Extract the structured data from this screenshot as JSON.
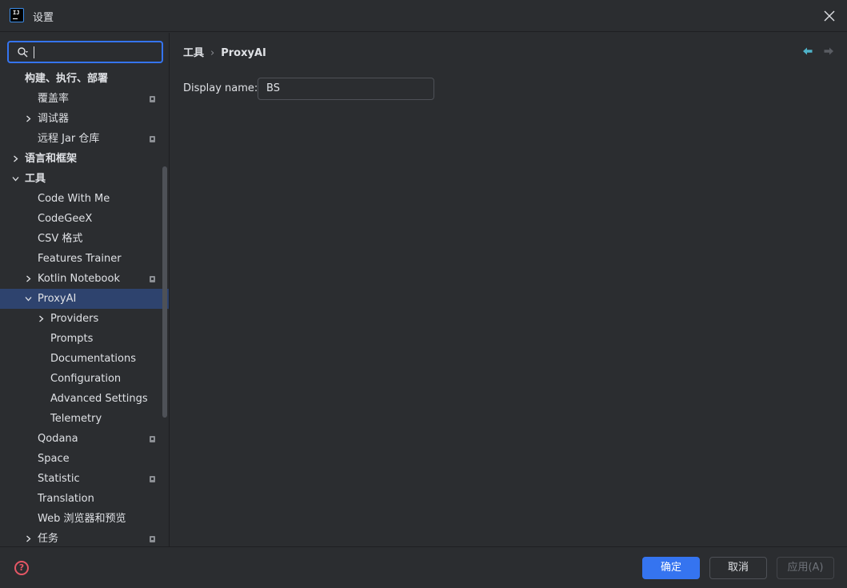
{
  "window": {
    "title": "设置",
    "app_icon_text": "IJ"
  },
  "search": {
    "value": "",
    "placeholder": ""
  },
  "tree": [
    {
      "label": "构建、执行、部署",
      "level": 0,
      "bold": true,
      "chevron": "none",
      "locked": false,
      "selected": false
    },
    {
      "label": "覆盖率",
      "level": 1,
      "bold": false,
      "chevron": "none",
      "locked": true,
      "selected": false
    },
    {
      "label": "调试器",
      "level": 1,
      "bold": false,
      "chevron": "right",
      "locked": false,
      "selected": false
    },
    {
      "label": "远程 Jar 仓库",
      "level": 1,
      "bold": false,
      "chevron": "none",
      "locked": true,
      "selected": false
    },
    {
      "label": "语言和框架",
      "level": 0,
      "bold": true,
      "chevron": "right",
      "locked": false,
      "selected": false
    },
    {
      "label": "工具",
      "level": 0,
      "bold": true,
      "chevron": "down",
      "locked": false,
      "selected": false
    },
    {
      "label": "Code With Me",
      "level": 1,
      "bold": false,
      "chevron": "none",
      "locked": false,
      "selected": false
    },
    {
      "label": "CodeGeeX",
      "level": 1,
      "bold": false,
      "chevron": "none",
      "locked": false,
      "selected": false
    },
    {
      "label": "CSV 格式",
      "level": 1,
      "bold": false,
      "chevron": "none",
      "locked": false,
      "selected": false
    },
    {
      "label": "Features Trainer",
      "level": 1,
      "bold": false,
      "chevron": "none",
      "locked": false,
      "selected": false
    },
    {
      "label": "Kotlin Notebook",
      "level": 1,
      "bold": false,
      "chevron": "right",
      "locked": true,
      "selected": false
    },
    {
      "label": "ProxyAI",
      "level": 1,
      "bold": false,
      "chevron": "down",
      "locked": false,
      "selected": true
    },
    {
      "label": "Providers",
      "level": 2,
      "bold": false,
      "chevron": "right",
      "locked": false,
      "selected": false
    },
    {
      "label": "Prompts",
      "level": 2,
      "bold": false,
      "chevron": "none",
      "locked": false,
      "selected": false
    },
    {
      "label": "Documentations",
      "level": 2,
      "bold": false,
      "chevron": "none",
      "locked": false,
      "selected": false
    },
    {
      "label": "Configuration",
      "level": 2,
      "bold": false,
      "chevron": "none",
      "locked": false,
      "selected": false
    },
    {
      "label": "Advanced Settings",
      "level": 2,
      "bold": false,
      "chevron": "none",
      "locked": false,
      "selected": false
    },
    {
      "label": "Telemetry",
      "level": 2,
      "bold": false,
      "chevron": "none",
      "locked": false,
      "selected": false
    },
    {
      "label": "Qodana",
      "level": 1,
      "bold": false,
      "chevron": "none",
      "locked": true,
      "selected": false
    },
    {
      "label": "Space",
      "level": 1,
      "bold": false,
      "chevron": "none",
      "locked": false,
      "selected": false
    },
    {
      "label": "Statistic",
      "level": 1,
      "bold": false,
      "chevron": "none",
      "locked": true,
      "selected": false
    },
    {
      "label": "Translation",
      "level": 1,
      "bold": false,
      "chevron": "none",
      "locked": false,
      "selected": false
    },
    {
      "label": "Web 浏览器和预览",
      "level": 1,
      "bold": false,
      "chevron": "none",
      "locked": false,
      "selected": false
    },
    {
      "label": "任务",
      "level": 1,
      "bold": false,
      "chevron": "right",
      "locked": true,
      "selected": false
    }
  ],
  "breadcrumb": {
    "parent": "工具",
    "separator": "›",
    "current": "ProxyAI"
  },
  "form": {
    "display_name_label": "Display name:",
    "display_name_value": "BS"
  },
  "footer": {
    "ok_label": "确定",
    "cancel_label": "取消",
    "apply_label": "应用(A)",
    "help_glyph": "?"
  },
  "colors": {
    "accent": "#3574f0",
    "selection": "#2e436e",
    "background": "#2b2d30",
    "help": "#e55765",
    "nav_arrow_active": "#4fb3c9"
  },
  "icons": {
    "search": "search-icon",
    "close": "close-icon",
    "back": "arrow-left-icon",
    "forward": "arrow-right-icon",
    "help": "help-circle-icon",
    "lock": "lock-icon"
  }
}
